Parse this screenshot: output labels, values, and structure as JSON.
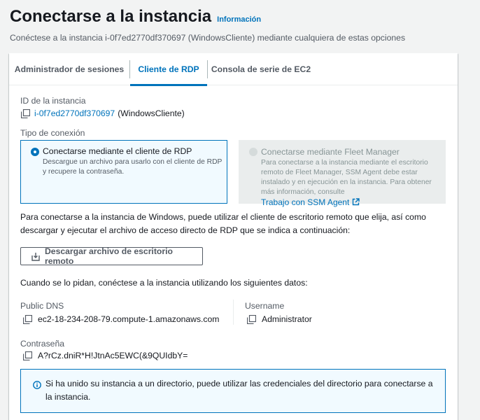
{
  "header": {
    "title": "Conectarse a la instancia",
    "info_link": "Información",
    "subtitle": "Conéctese a la instancia i-0f7ed2770df370697 (WindowsCliente) mediante cualquiera de estas opciones"
  },
  "tabs": [
    {
      "label": "Administrador de sesiones",
      "active": false
    },
    {
      "label": "Cliente de RDP",
      "active": true
    },
    {
      "label": "Consola de serie de EC2",
      "active": false
    }
  ],
  "instance": {
    "id_label": "ID de la instancia",
    "id_value": "i-0f7ed2770df370697",
    "name_value": "(WindowsCliente)"
  },
  "connection_type": {
    "label": "Tipo de conexión",
    "options": [
      {
        "title": "Conectarse mediante el cliente de RDP",
        "description": "Descargue un archivo para usarlo con el cliente de RDP y recupere la contraseña.",
        "selected": true
      },
      {
        "title": "Conectarse mediante Fleet Manager",
        "description": "Para conectarse a la instancia mediante el escritorio remoto de Fleet Manager, SSM Agent debe estar instalado y en ejecución en la instancia. Para obtener más información, consulte",
        "link_text": "Trabajo con SSM Agent",
        "selected": false,
        "disabled": true
      }
    ]
  },
  "instructions": {
    "rdp_text": "Para conectarse a la instancia de Windows, puede utilizar el cliente de escritorio remoto que elija, así como descargar y ejecutar el archivo de acceso directo de RDP que se indica a continuación:",
    "download_button": "Descargar archivo de escritorio remoto",
    "prompt_text": "Cuando se lo pidan, conéctese a la instancia utilizando los siguientes datos:"
  },
  "details": {
    "dns_label": "Public DNS",
    "dns_value": "ec2-18-234-208-79.compute-1.amazonaws.com",
    "username_label": "Username",
    "username_value": "Administrator",
    "password_label": "Contraseña",
    "password_value": "A?rCz.dniR*H!JtnAc5EWC(&9QUIdbY="
  },
  "alert": {
    "text": "Si ha unido su instancia a un directorio, puede utilizar las credenciales del directorio para conectarse a la instancia."
  },
  "colors": {
    "accent": "#0073bb",
    "background": "#f2f3f3",
    "text": "#16191f",
    "muted": "#545b64",
    "disabled_tile": "#eaeded"
  },
  "icons": [
    "copy-icon",
    "download-icon",
    "external-link-icon",
    "info-icon"
  ]
}
